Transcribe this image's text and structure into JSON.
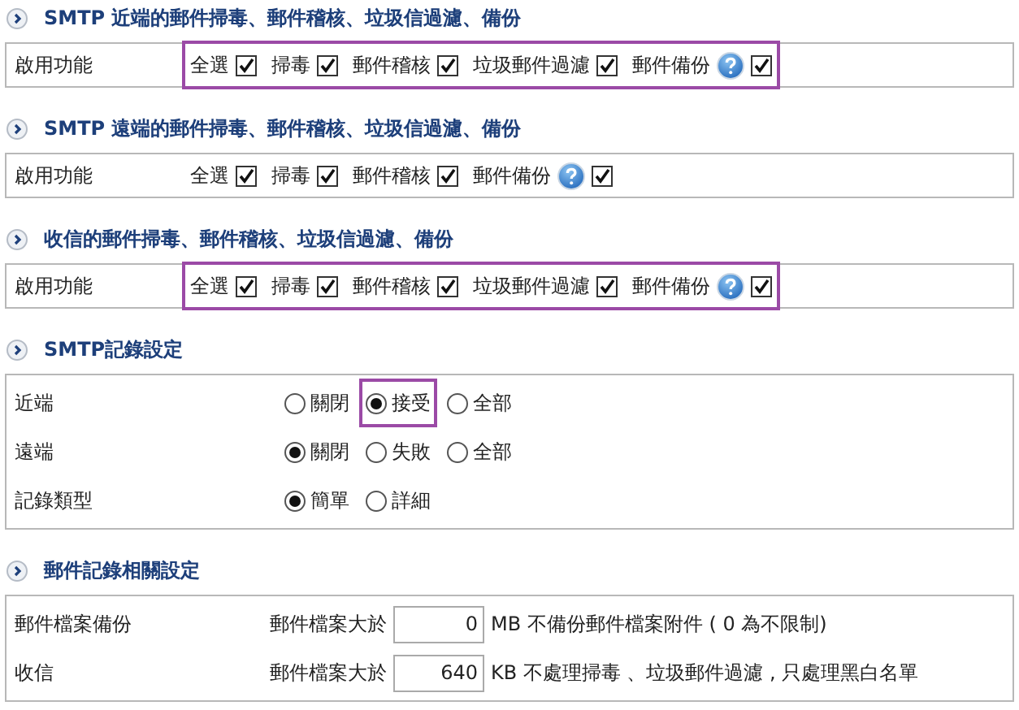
{
  "sections": [
    {
      "kind": "checkboxes",
      "title": "SMTP 近端的郵件掃毒、郵件稽核、垃圾信過濾、備份",
      "rows": [
        {
          "label": "啟用功能",
          "highlighted": true,
          "options": [
            {
              "label": "全選",
              "checked": true
            },
            {
              "label": "掃毒",
              "checked": true
            },
            {
              "label": "郵件稽核",
              "checked": true
            },
            {
              "label": "垃圾郵件過濾",
              "checked": true
            },
            {
              "label": "郵件備份",
              "checked": true,
              "help": true
            }
          ]
        }
      ]
    },
    {
      "kind": "checkboxes",
      "title": "SMTP 遠端的郵件掃毒、郵件稽核、垃圾信過濾、備份",
      "rows": [
        {
          "label": "啟用功能",
          "highlighted": false,
          "options": [
            {
              "label": "全選",
              "checked": true
            },
            {
              "label": "掃毒",
              "checked": true
            },
            {
              "label": "郵件稽核",
              "checked": true
            },
            {
              "label": "郵件備份",
              "checked": true,
              "help": true
            }
          ]
        }
      ]
    },
    {
      "kind": "checkboxes",
      "title": "收信的郵件掃毒、郵件稽核、垃圾信過濾、備份",
      "rows": [
        {
          "label": "啟用功能",
          "highlighted": true,
          "options": [
            {
              "label": "全選",
              "checked": true
            },
            {
              "label": "掃毒",
              "checked": true
            },
            {
              "label": "郵件稽核",
              "checked": true
            },
            {
              "label": "垃圾郵件過濾",
              "checked": true
            },
            {
              "label": "郵件備份",
              "checked": true,
              "help": true
            }
          ]
        }
      ]
    },
    {
      "kind": "radios",
      "title": "SMTP記錄設定",
      "rows": [
        {
          "label": "近端",
          "options": [
            {
              "label": "關閉",
              "selected": false,
              "highlighted": false
            },
            {
              "label": "接受",
              "selected": true,
              "highlighted": true
            },
            {
              "label": "全部",
              "selected": false,
              "highlighted": false
            }
          ]
        },
        {
          "label": "遠端",
          "options": [
            {
              "label": "關閉",
              "selected": true,
              "highlighted": false
            },
            {
              "label": "失敗",
              "selected": false,
              "highlighted": false
            },
            {
              "label": "全部",
              "selected": false,
              "highlighted": false
            }
          ]
        },
        {
          "label": "記錄類型",
          "options": [
            {
              "label": "簡單",
              "selected": true,
              "highlighted": false
            },
            {
              "label": "詳細",
              "selected": false,
              "highlighted": false
            }
          ]
        }
      ]
    },
    {
      "kind": "fields",
      "title": "郵件記錄相關設定",
      "rows": [
        {
          "label": "郵件檔案備份",
          "prefix": "郵件檔案大於",
          "value": "0",
          "suffix": "MB 不備份郵件檔案附件 ( 0 為不限制)"
        },
        {
          "label": "收信",
          "prefix": "郵件檔案大於",
          "value": "640",
          "suffix": "KB 不處理掃毒 、垃圾郵件過濾 , 只處理黑白名單"
        }
      ]
    }
  ]
}
